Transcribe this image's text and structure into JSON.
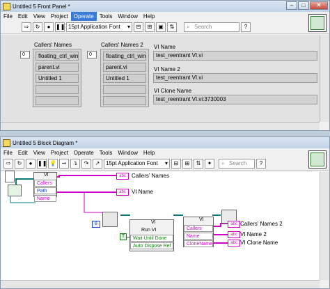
{
  "front_panel": {
    "title": "Untitled 5 Front Panel *",
    "menu": [
      "File",
      "Edit",
      "View",
      "Project",
      "Operate",
      "Tools",
      "Window",
      "Help"
    ],
    "active_menu": "Operate",
    "font": "15pt Application Font",
    "search_placeholder": "Search",
    "callers_label": "Callers' Names",
    "callers_index": "0",
    "callers_values": [
      "floating_ctrl_win",
      "parent.vi",
      "Untitled 1",
      "",
      ""
    ],
    "callers2_label": "Callers' Names 2",
    "callers2_index": "0",
    "callers2_values": [
      "floating_ctrl_win",
      "parent.vi",
      "Untitled 1",
      "",
      ""
    ],
    "vi_name_label": "VI Name",
    "vi_name_value": "test_reentrant VI.vi",
    "vi_name2_label": "VI Name 2",
    "vi_name2_value": "test_reentrant VI.vi",
    "vi_clone_label": "VI Clone Name",
    "vi_clone_value": "test_reentrant VI.vi:3730003"
  },
  "block_diagram": {
    "title": "Untitled 5 Block Diagram *",
    "menu": [
      "File",
      "Edit",
      "View",
      "Project",
      "Operate",
      "Tools",
      "Window",
      "Help"
    ],
    "font": "15pt Application Font",
    "search_placeholder": "Search",
    "node1_header": "VI",
    "node1_terms": [
      "Callers",
      "Path",
      "Name"
    ],
    "out_callers": "Callers' Names",
    "out_vi_name": "VI Name",
    "const_value": "8",
    "node2_header": "VI",
    "node2_sub": "Run VI",
    "wait_label": "Wait Until Done",
    "auto_label": "Auto Dispose Ref",
    "bool_const": "T",
    "node3_header": "VI",
    "node3_terms": [
      "Callers",
      "Name",
      "CloneName"
    ],
    "out_callers2": "Callers' Names 2",
    "out_vi_name2": "VI Name 2",
    "out_clone": "VI Clone Name",
    "str_tag": "abc"
  }
}
